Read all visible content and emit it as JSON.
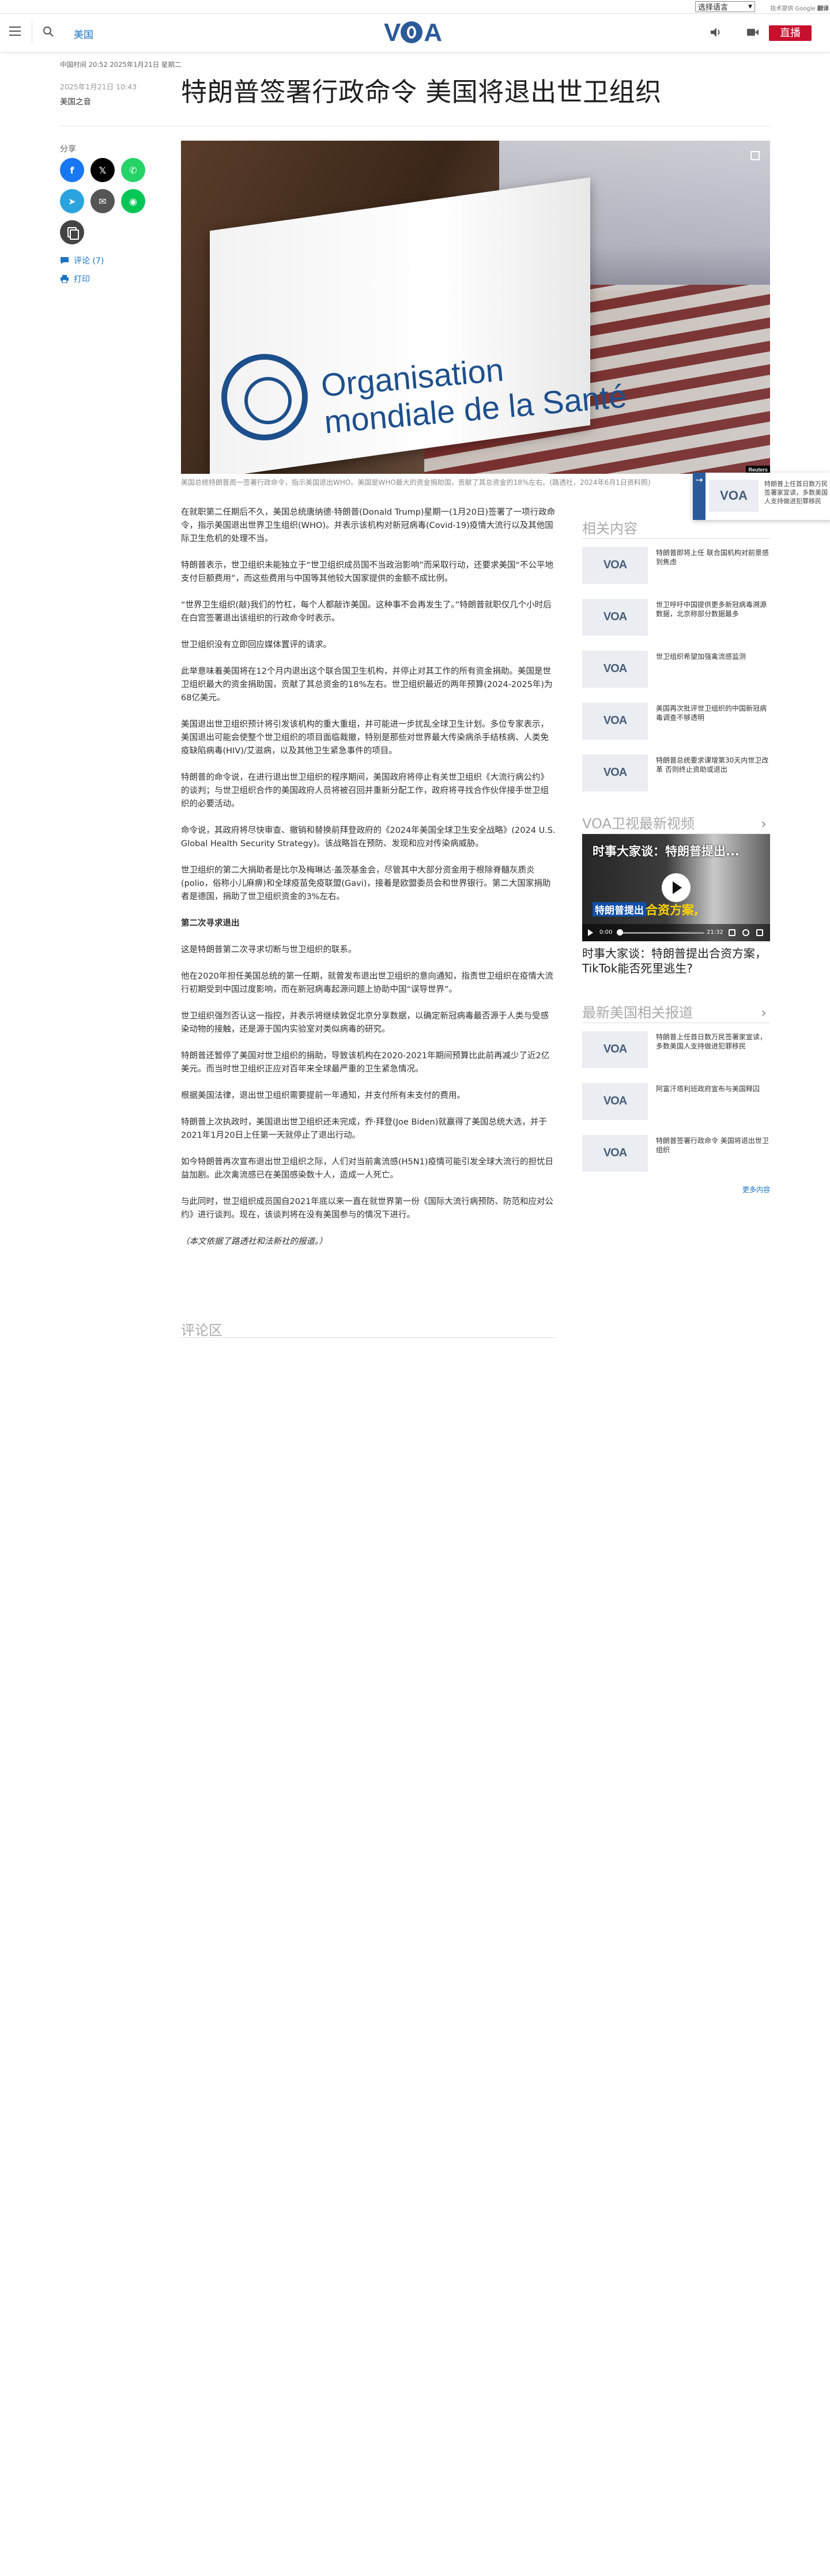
{
  "translate": {
    "select_label": "选择语言",
    "powered_prefix": "技术提供",
    "powered_brand": "Google",
    "powered_suffix": "翻译"
  },
  "header": {
    "section": "美国",
    "live_label": "直播",
    "logo_text": "VOA"
  },
  "article": {
    "update_line": "中国时间 20:52 2025年1月21日 星期二",
    "pub_date": "2025年1月21日 10:43",
    "byline": "美国之音",
    "headline": "特朗普签署行政命令 美国将退出世卫组织",
    "share_label": "分享",
    "comments_link": "评论 (7)",
    "print_link": "打印",
    "image_credit": "Reuters",
    "caption": "美国总统特朗普周一签署行政命令，指示美国退出WHO。美国是WHO最大的资金捐助国，贡献了其总资金的18%左右。(路透社，2024年6月1日资料照)",
    "paragraphs": [
      {
        "text": "在就职第二任期后不久，美国总统唐纳德·特朗普(Donald Trump)星期一(1月20日)签署了一项行政命令，指示美国退出世界卫生组织(WHO)。并表示该机构对新冠病毒(Covid-19)疫情大流行以及其他国际卫生危机的处理不当。",
        "kind": "normal"
      },
      {
        "text": "特朗普表示，世卫组织未能独立于“世卫组织成员国不当政治影响”而采取行动，还要求美国“不公平地支付巨额费用”，而这些费用与中国等其他较大国家提供的金额不成比例。",
        "kind": "normal"
      },
      {
        "text": "“世界卫生组织(敲)我们的竹杠，每个人都敲诈美国。这种事不会再发生了。”特朗普就职仅几个小时后在白宫签署退出该组织的行政命令时表示。",
        "kind": "normal"
      },
      {
        "text": "世卫组织没有立即回应媒体置评的请求。",
        "kind": "normal"
      },
      {
        "text": "此举意味着美国将在12个月内退出这个联合国卫生机构，并停止对其工作的所有资金捐助。美国是世卫组织最大的资金捐助国，贡献了其总资金的18%左右。世卫组织最近的两年预算(2024-2025年)为68亿美元。",
        "kind": "normal"
      },
      {
        "text": "美国退出世卫组织预计将引发该机构的重大重组，并可能进一步扰乱全球卫生计划。多位专家表示，美国退出可能会使整个世卫组织的项目面临裁撤，特别是那些对世界最大传染病杀手结核病、人类免疫缺陷病毒(HIV)/艾滋病，以及其他卫生紧急事件的项目。",
        "kind": "normal"
      },
      {
        "text": "特朗普的命令说，在进行退出世卫组织的程序期间，美国政府将停止有关世卫组织《大流行病公约》的谈判；与世卫组织合作的美国政府人员将被召回并重新分配工作，政府将寻找合作伙伴接手世卫组织的必要活动。",
        "kind": "normal"
      },
      {
        "text": "命令说，其政府将尽快审查、撤销和替换前拜登政府的《2024年美国全球卫生安全战略》(2024 U.S. Global Health Security Strategy)。该战略旨在预防、发现和应对传染病威胁。",
        "kind": "normal"
      },
      {
        "text": "世卫组织的第二大捐助者是比尔及梅琳达·盖茨基金会，尽管其中大部分资金用于根除脊髓灰质炎(polio，俗称小儿麻痹)和全球疫苗免疫联盟(Gavi)，接着是欧盟委员会和世界银行。第二大国家捐助者是德国，捐助了世卫组织资金的3%左右。",
        "kind": "normal"
      },
      {
        "text": "第二次寻求退出",
        "kind": "subhead"
      },
      {
        "text": "这是特朗普第二次寻求切断与世卫组织的联系。",
        "kind": "normal"
      },
      {
        "text": "他在2020年担任美国总统的第一任期，就曾发布退出世卫组织的意向通知，指责世卫组织在疫情大流行初期受到中国过度影响，而在新冠病毒起源问题上协助中国“误导世界”。",
        "kind": "normal"
      },
      {
        "text": "世卫组织强烈否认这一指控，并表示将继续敦促北京分享数据，以确定新冠病毒最否源于人类与受感染动物的接触，还是源于国内实验室对类似病毒的研究。",
        "kind": "normal"
      },
      {
        "text": "特朗普还暂停了美国对世卫组织的捐助，导致该机构在2020-2021年期间预算比此前再减少了近2亿美元。而当时世卫组织正应对百年来全球最严重的卫生紧急情况。",
        "kind": "normal"
      },
      {
        "text": "根据美国法律，退出世卫组织需要提前一年通知，并支付所有未支付的费用。",
        "kind": "normal"
      },
      {
        "text": "特朗普上次执政时，美国退出世卫组织还未完成，乔·拜登(Joe Biden)就赢得了美国总统大选，并于2021年1月20日上任第一天就停止了退出行动。",
        "kind": "normal"
      },
      {
        "text": "如今特朗普再次宣布退出世卫组织之际，人们对当前禽流感(H5N1)疫情可能引发全球大流行的担忧日益加剧。此次禽流感已在美国感染数十人，造成一人死亡。",
        "kind": "normal"
      },
      {
        "text": "与此同时，世卫组织成员国自2021年底以来一直在就世界第一份《国际大流行病预防、防范和应对公约》进行谈判。现在，该谈判将在没有美国参与的情况下进行。",
        "kind": "normal"
      },
      {
        "text": "（本文依据了路透社和法新社的报道。）",
        "kind": "note"
      }
    ],
    "comments_title": "评论区"
  },
  "rail": {
    "related_title": "相关内容",
    "related": [
      {
        "text": "特朗普即将上任 联合国机构对前景感到焦虑"
      },
      {
        "text": "世卫呼吁中国提供更多新冠病毒溯源数据，北京称部分数据最多"
      },
      {
        "text": "世卫组织希望加强禽流感监测"
      },
      {
        "text": "美国再次批评世卫组织的中国新冠病毒调查不够透明"
      },
      {
        "text": "特朗普总统要求课增第30天内世卫改革 否则终止资助或退出"
      }
    ],
    "video_section_title": "VOA卫视最新视频",
    "video_overlay_title": "时事大家谈：特朗普提出...",
    "video_overlay_tag": "特朗普提出",
    "video_overlay_highlight": "合资方案,",
    "video_time_current": "0:00",
    "video_time_total": "21:32",
    "video_title": "时事大家谈：特朗普提出合资方案，TikTok能否死里逃生?",
    "latest_title": "最新美国相关报道",
    "latest": [
      {
        "text": "特朗普上任首日数万民签署家宣读，多数美国人支持做进犯罪移民"
      },
      {
        "text": "阿富汗塔利班政府宣布与美国释囚"
      },
      {
        "text": "特朗普签署行政命令 美国将退出世卫组织"
      }
    ],
    "more_label": "更多内容"
  },
  "promo": {
    "text": "特朗普上任首日数万民签署家宣读，多数美国人支持做进犯罪移民",
    "logo_text": "VOA"
  },
  "colors": {
    "brand": "#2b5a9a",
    "live": "#c8102e",
    "link": "#1a73c4"
  },
  "icons": [
    "menu-icon",
    "search-icon",
    "audio-icon",
    "video-icon",
    "facebook-icon",
    "x-icon",
    "whatsapp-icon",
    "telegram-icon",
    "email-icon",
    "line-icon",
    "copy-link-icon",
    "comment-icon",
    "print-icon",
    "fullscreen-icon",
    "chevron-right-icon",
    "play-icon"
  ]
}
